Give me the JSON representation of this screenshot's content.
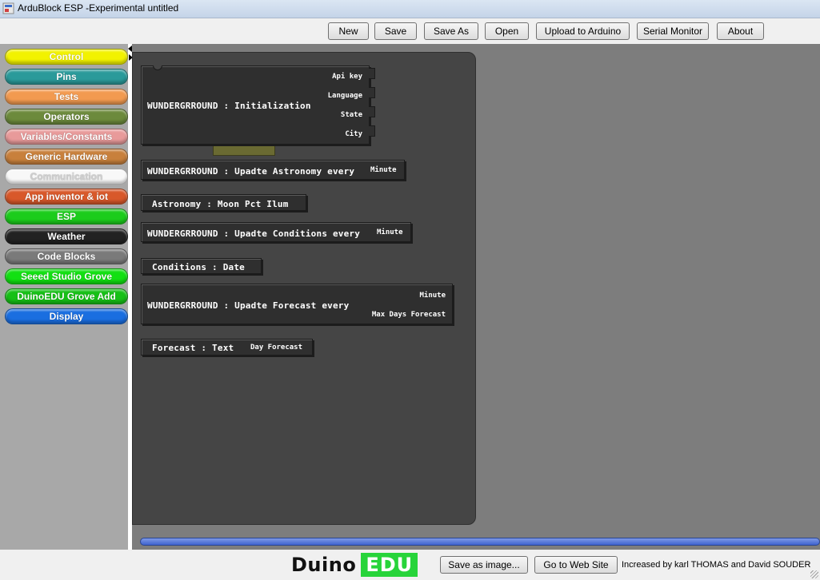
{
  "window": {
    "title": "ArduBlock ESP -Experimental untitled"
  },
  "toolbar": {
    "buttons": [
      "New",
      "Save",
      "Save As",
      "Open",
      "Upload to Arduino",
      "Serial Monitor",
      "About"
    ]
  },
  "palette": {
    "categories": [
      {
        "label": "Control",
        "color": "#f2f200"
      },
      {
        "label": "Pins",
        "color": "#2a9a9a"
      },
      {
        "label": "Tests",
        "color": "#f29a50"
      },
      {
        "label": "Operators",
        "color": "#6c8a3c"
      },
      {
        "label": "Variables/Constants",
        "color": "#e89a9a"
      },
      {
        "label": "Generic Hardware",
        "color": "#c8803c"
      },
      {
        "label": "Communication",
        "color": "#f8f8f8"
      },
      {
        "label": "App inventor & iot",
        "color": "#d8582a"
      },
      {
        "label": "ESP",
        "color": "#1ccc1c"
      },
      {
        "label": "Weather",
        "color": "#222222"
      },
      {
        "label": "Code Blocks",
        "color": "#7a7a7a"
      },
      {
        "label": "Seeed Studio Grove",
        "color": "#12e012"
      },
      {
        "label": "DuinoEDU Grove Add",
        "color": "#16c016"
      },
      {
        "label": "Display",
        "color": "#1a6ee0"
      }
    ]
  },
  "blocks": {
    "init": {
      "label": "WUNDERGRROUND : Initialization",
      "sockets": [
        "Api key",
        "Language",
        "State",
        "City"
      ]
    },
    "astronomy_update": {
      "label": "WUNDERGRROUND : Upadte Astronomy every",
      "socket": "Minute"
    },
    "moon": {
      "label": "Astronomy : Moon Pct Ilum"
    },
    "conditions_update": {
      "label": "WUNDERGRROUND : Upadte Conditions every",
      "socket": "Minute"
    },
    "conditions_date": {
      "label": "Conditions : Date"
    },
    "forecast_update": {
      "label": "WUNDERGRROUND : Upadte Forecast every",
      "sockets": [
        "Minute",
        "Max Days Forecast"
      ]
    },
    "forecast_text": {
      "label": "Forecast : Text",
      "socket": "Day Forecast"
    }
  },
  "footer": {
    "logo_left": "Duino",
    "logo_right": "EDU",
    "save_image": "Save as image...",
    "website": "Go to Web Site",
    "credits": "Increased by karl THOMAS and David SOUDER"
  }
}
